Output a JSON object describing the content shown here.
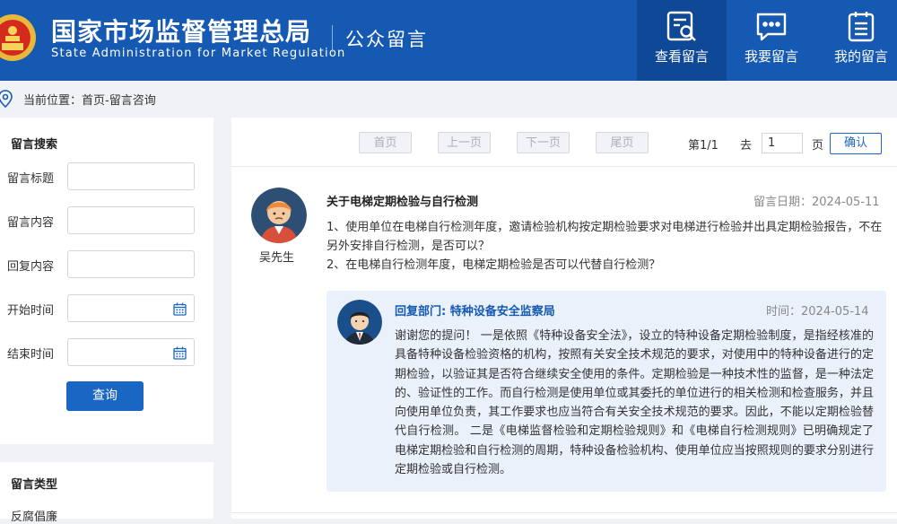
{
  "header": {
    "title_cn": "国家市场监督管理总局",
    "title_en": "State Administration for Market Regulation",
    "section_title": "公众留言",
    "nav": [
      {
        "label": "查看留言",
        "icon": "search-document-icon",
        "active": true
      },
      {
        "label": "我要留言",
        "icon": "chat-bubble-icon",
        "active": false
      },
      {
        "label": "我的留言",
        "icon": "list-document-icon",
        "active": false
      }
    ],
    "brand_color": "#1559b3"
  },
  "breadcrumb": {
    "text": "当前位置：首页-留言咨询",
    "icon": "location-pin-icon"
  },
  "search": {
    "title": "留言搜索",
    "fields": [
      {
        "label": "留言标题",
        "value": "",
        "type": "text"
      },
      {
        "label": "留言内容",
        "value": "",
        "type": "text"
      },
      {
        "label": "回复内容",
        "value": "",
        "type": "text"
      },
      {
        "label": "开始时间",
        "value": "",
        "type": "date"
      },
      {
        "label": "结束时间",
        "value": "",
        "type": "date"
      }
    ],
    "button": "查询"
  },
  "types": {
    "title": "留言类型",
    "first_item": "反腐倡廉"
  },
  "pager": {
    "first": "首页",
    "prev": "上一页",
    "next": "下一页",
    "last": "尾页",
    "page_info": "第1/1",
    "goto_label": "去",
    "goto_value": "1",
    "page_label": "页",
    "confirm": "确认"
  },
  "message": {
    "author": "吴先生",
    "title": "关于电梯定期检验与自行检测",
    "date": "留言日期：2024-05-11",
    "body": [
      "1、使用单位在电梯自行检测年度，邀请检验机构按定期检验要求对电梯进行检验并出具定期检验报告，不在另外安排自行检测，是否可以？",
      "2、在电梯自行检测年度，电梯定期检验是否可以代替自行检测？"
    ],
    "reply": {
      "dept": "回复部门: 特种设备安全监察局",
      "date": "时间：2024-05-14",
      "body": "谢谢您的提问！ 一是依照《特种设备安全法》，设立的特种设备定期检验制度，是指经核准的具备特种设备检验资格的机构，按照有关安全技术规范的要求，对使用中的特种设备进行的定期检验，以验证其是否符合继续安全使用的条件。定期检验是一种技术性的监督，是一种法定的、验证性的工作。而自行检测是使用单位或其委托的单位进行的相关检测和检查服务，并且向使用单位负责，其工作要求也应当符合有关安全技术规范的要求。因此，不能以定期检验替代自行检测。 二是《电梯监督检验和定期检验规则》和《电梯自行检测规则》已明确规定了电梯定期检验和自行检测的周期，特种设备检验机构、使用单位应当按照规则的要求分别进行定期检验或自行检测。"
    }
  }
}
